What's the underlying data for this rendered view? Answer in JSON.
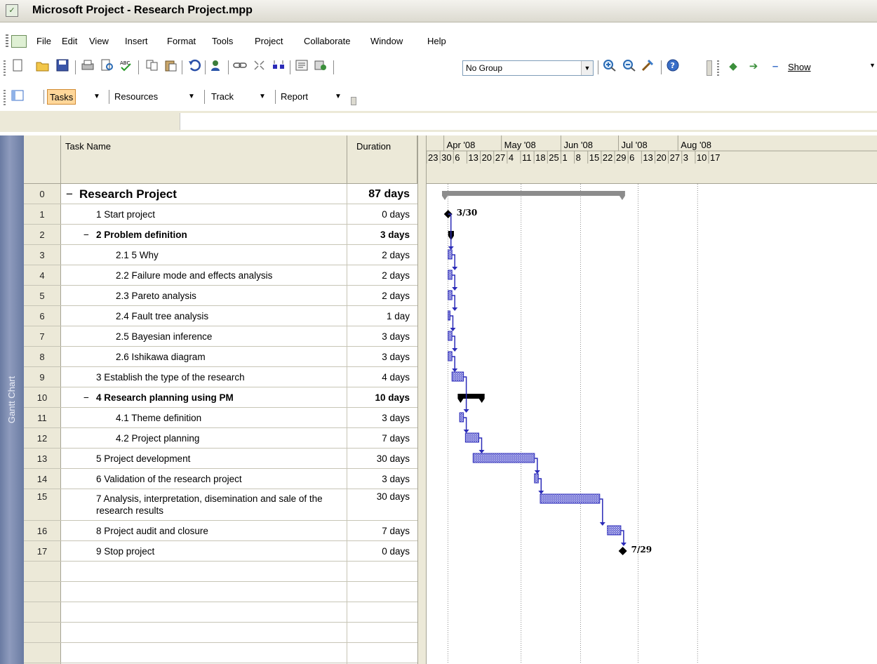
{
  "window": {
    "title": "Microsoft Project - Research Project.mpp"
  },
  "menu": [
    "File",
    "Edit",
    "View",
    "Insert",
    "Format",
    "Tools",
    "Project",
    "Collaborate",
    "Window",
    "Help"
  ],
  "toolbar": {
    "group_value": "No Group",
    "show_label": "Show",
    "icons": [
      "new-icon",
      "open-icon",
      "save-icon",
      "print-icon",
      "print-preview-icon",
      "spelling-icon",
      "copy-icon",
      "paste-icon",
      "undo-icon",
      "assign-resources-icon",
      "link-tasks-icon",
      "unlink-tasks-icon",
      "split-task-icon",
      "task-information-icon",
      "publish-icon",
      "zoom-in-icon",
      "zoom-out-icon",
      "go-to-task-icon",
      "help-icon",
      "scroll-back-icon",
      "scroll-forward-icon",
      "outline-hide-icon"
    ]
  },
  "guide": {
    "tasks": "Tasks",
    "resources": "Resources",
    "track": "Track",
    "report": "Report"
  },
  "view_bar": {
    "label": "Gantt Chart"
  },
  "table": {
    "headers": {
      "name": "Task Name",
      "duration": "Duration"
    },
    "rows": [
      {
        "id": "0",
        "name": "Research Project",
        "duration": "87 days",
        "indent": 0,
        "summary": true,
        "big": true
      },
      {
        "id": "1",
        "name": "1 Start project",
        "duration": "0 days",
        "indent": 1
      },
      {
        "id": "2",
        "name": "2 Problem definition",
        "duration": "3 days",
        "indent": 1,
        "summary": true
      },
      {
        "id": "3",
        "name": "2.1 5 Why",
        "duration": "2 days",
        "indent": 2
      },
      {
        "id": "4",
        "name": "2.2 Failure mode and effects analysis",
        "duration": "2 days",
        "indent": 2
      },
      {
        "id": "5",
        "name": "2.3 Pareto analysis",
        "duration": "2 days",
        "indent": 2
      },
      {
        "id": "6",
        "name": "2.4 Fault tree analysis",
        "duration": "1 day",
        "indent": 2
      },
      {
        "id": "7",
        "name": "2.5 Bayesian inference",
        "duration": "3 days",
        "indent": 2
      },
      {
        "id": "8",
        "name": "2.6 Ishikawa diagram",
        "duration": "3 days",
        "indent": 2
      },
      {
        "id": "9",
        "name": "3 Establish the type of the research",
        "duration": "4 days",
        "indent": 1
      },
      {
        "id": "10",
        "name": "4 Research planning using PM",
        "duration": "10 days",
        "indent": 1,
        "summary": true
      },
      {
        "id": "11",
        "name": "4.1 Theme definition",
        "duration": "3 days",
        "indent": 2
      },
      {
        "id": "12",
        "name": "4.2 Project planning",
        "duration": "7 days",
        "indent": 2
      },
      {
        "id": "13",
        "name": "5 Project development",
        "duration": "30 days",
        "indent": 1
      },
      {
        "id": "14",
        "name": "6 Validation of the research project",
        "duration": "3 days",
        "indent": 1
      },
      {
        "id": "15",
        "name": "7 Analysis, interpretation, disemination and sale of the research results",
        "duration": "30 days",
        "indent": 1
      },
      {
        "id": "16",
        "name": "8 Project audit and closure",
        "duration": "7 days",
        "indent": 1
      },
      {
        "id": "17",
        "name": "9 Stop project",
        "duration": "0 days",
        "indent": 1
      }
    ],
    "empty_rows": 6
  },
  "timescale": {
    "months": [
      "Apr '08",
      "May '08",
      "Jun '08",
      "Jul '08",
      "Aug '08"
    ],
    "weeks": [
      "23",
      "30",
      "6",
      "13",
      "20",
      "27",
      "4",
      "11",
      "18",
      "25",
      "1",
      "8",
      "15",
      "22",
      "29",
      "6",
      "13",
      "20",
      "27",
      "3",
      "10",
      "17"
    ]
  },
  "gantt": {
    "task_color": "#2b2bb8",
    "summary_color": "#000000",
    "project_summary_color": "#8c8c8c",
    "milestone_labels": {
      "start": "3/30",
      "end": "7/29"
    },
    "bars": [
      {
        "row": 0,
        "start": 0,
        "dur": 91,
        "kind": "project"
      },
      {
        "row": 1,
        "start": 1,
        "dur": 0,
        "kind": "milestone",
        "label": "start"
      },
      {
        "row": 2,
        "start": 1,
        "dur": 3,
        "kind": "summary"
      },
      {
        "row": 3,
        "start": 1,
        "dur": 2,
        "kind": "task"
      },
      {
        "row": 4,
        "start": 1,
        "dur": 2,
        "kind": "task"
      },
      {
        "row": 5,
        "start": 1,
        "dur": 2,
        "kind": "task"
      },
      {
        "row": 6,
        "start": 1,
        "dur": 1,
        "kind": "task"
      },
      {
        "row": 7,
        "start": 1,
        "dur": 2,
        "kind": "task"
      },
      {
        "row": 8,
        "start": 1,
        "dur": 2,
        "kind": "task"
      },
      {
        "row": 9,
        "start": 3,
        "dur": 6,
        "kind": "task"
      },
      {
        "row": 10,
        "start": 6,
        "dur": 14,
        "kind": "summary"
      },
      {
        "row": 11,
        "start": 7,
        "dur": 2,
        "kind": "task"
      },
      {
        "row": 12,
        "start": 10,
        "dur": 7,
        "kind": "task"
      },
      {
        "row": 13,
        "start": 14,
        "dur": 32,
        "kind": "task"
      },
      {
        "row": 14,
        "start": 46,
        "dur": 2,
        "kind": "task"
      },
      {
        "row": 15,
        "start": 49,
        "dur": 31,
        "kind": "task"
      },
      {
        "row": 16,
        "start": 84,
        "dur": 7,
        "kind": "task"
      },
      {
        "row": 17,
        "start": 92,
        "dur": 0,
        "kind": "milestone",
        "label": "end"
      }
    ]
  }
}
